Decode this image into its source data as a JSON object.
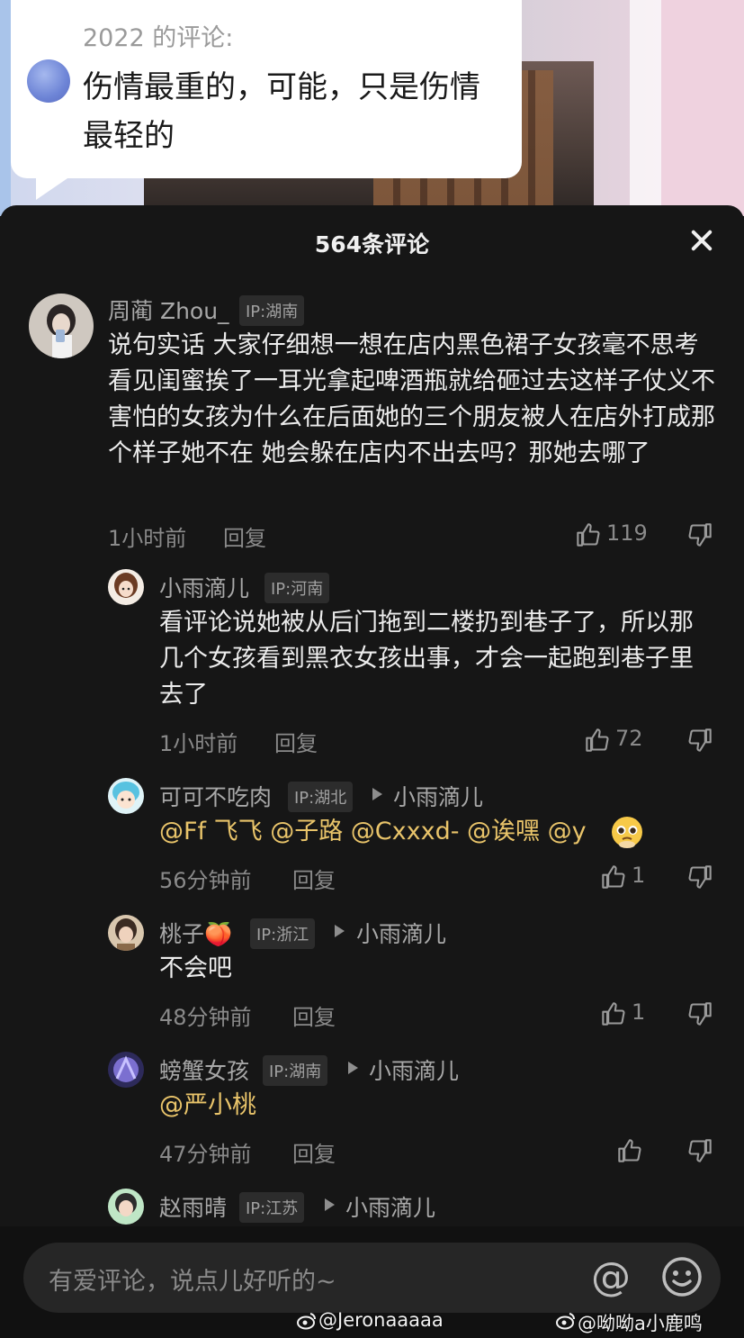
{
  "quoted": {
    "year_label": "2022 的评论:",
    "text": "伤情最重的，可能，只是伤情最轻的"
  },
  "sheet": {
    "title": "564条评论"
  },
  "comments": [
    {
      "username": "周蔺 Zhou_",
      "ip": "IP:湖南",
      "reply_to": "",
      "text": "说句实话 大家仔细想一想在店内黑色裙子女孩毫不思考 看见闺蜜挨了一耳光拿起啤酒瓶就给砸过去这样子仗义不害怕的女孩为什么在后面她的三个朋友被人在店外打成那个样子她不在 她会躲在店内不出去吗？那她去哪了",
      "time": "1小时前",
      "reply_label": "回复",
      "likes": "119"
    },
    {
      "username": "小雨滴儿",
      "ip": "IP:河南",
      "reply_to": "",
      "text": "看评论说她被从后门拖到二楼扔到巷子了，所以那几个女孩看到黑衣女孩出事，才会一起跑到巷子里去了",
      "time": "1小时前",
      "reply_label": "回复",
      "likes": "72"
    },
    {
      "username": "可可不吃肉",
      "ip": "IP:湖北",
      "reply_to": "小雨滴儿",
      "text": "@Ff 飞飞 @子路 @Cxxxd- @诶嘿 @y",
      "time": "56分钟前",
      "reply_label": "回复",
      "likes": "1"
    },
    {
      "username": "桃子🍑",
      "ip": "IP:浙江",
      "reply_to": "小雨滴儿",
      "text": "不会吧",
      "time": "48分钟前",
      "reply_label": "回复",
      "likes": "1"
    },
    {
      "username": "螃蟹女孩",
      "ip": "IP:湖南",
      "reply_to": "小雨滴儿",
      "text": "@严小桃",
      "time": "47分钟前",
      "reply_label": "回复",
      "likes": ""
    },
    {
      "username": "赵雨晴",
      "ip": "IP:江苏",
      "reply_to": "小雨滴儿"
    }
  ],
  "input": {
    "placeholder": "有爱评论，说点儿好听的~",
    "at_symbol": "@"
  },
  "watermarks": {
    "left": "@Jeronaaaaa",
    "right": "@呦呦a小鹿鸣"
  },
  "colors": {
    "mention": "#e9c46a",
    "sheet_bg": "#161616"
  }
}
